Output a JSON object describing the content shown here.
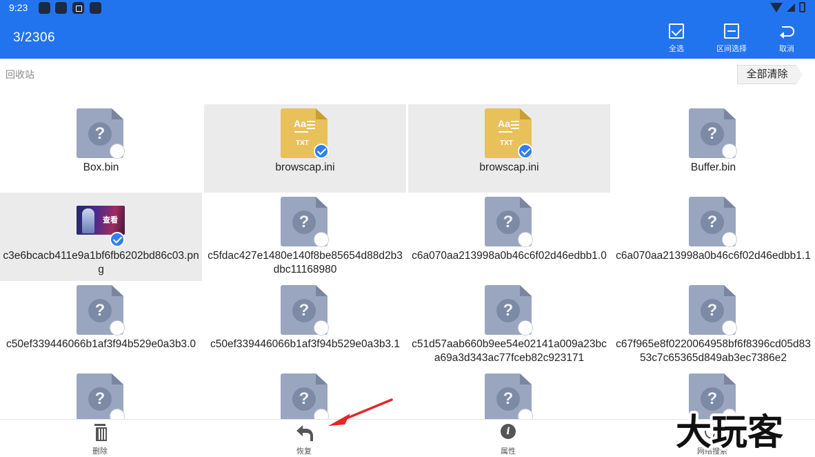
{
  "status_bar": {
    "time": "9:23"
  },
  "app_bar": {
    "selection_count": "3/2306",
    "actions": [
      {
        "label": "全选",
        "icon": "check-square-icon"
      },
      {
        "label": "区间选择",
        "icon": "range-select-icon"
      },
      {
        "label": "取消",
        "icon": "undo-icon"
      }
    ],
    "color": "#2273ee"
  },
  "breadcrumb": {
    "path": "回收站",
    "clear_all_label": "全部清除"
  },
  "files": [
    {
      "name": "Box.bin",
      "type": "unknown",
      "selected": false
    },
    {
      "name": "browscap.ini",
      "type": "txt",
      "selected": true
    },
    {
      "name": "browscap.ini",
      "type": "txt",
      "selected": true
    },
    {
      "name": "Buffer.bin",
      "type": "unknown",
      "selected": false
    },
    {
      "name": "c3e6bcacb411e9a1bf6fb6202bd86c03.png",
      "type": "image",
      "selected": true
    },
    {
      "name": "c5fdac427e1480e140f8be85654d88d2b3dbc11168980",
      "type": "unknown",
      "selected": false
    },
    {
      "name": "c6a070aa213998a0b46c6f02d46edbb1.0",
      "type": "unknown",
      "selected": false
    },
    {
      "name": "c6a070aa213998a0b46c6f02d46edbb1.1",
      "type": "unknown",
      "selected": false
    },
    {
      "name": "c50ef339446066b1af3f94b529e0a3b3.0",
      "type": "unknown",
      "selected": false
    },
    {
      "name": "c50ef339446066b1af3f94b529e0a3b3.1",
      "type": "unknown",
      "selected": false
    },
    {
      "name": "c51d57aab660b9ee54e02141a009a23bca69a3d343ac77fceb82c923171",
      "type": "unknown",
      "selected": false
    },
    {
      "name": "c67f965e8f0220064958bf6f8396cd05d8353c7c65365d849ab3ec7386e2",
      "type": "unknown",
      "selected": false
    },
    {
      "name": "",
      "type": "unknown",
      "selected": false
    },
    {
      "name": "",
      "type": "unknown",
      "selected": false
    },
    {
      "name": "",
      "type": "unknown",
      "selected": false
    },
    {
      "name": "",
      "type": "unknown",
      "selected": false
    }
  ],
  "file_icon_text": {
    "unknown": "?",
    "txt_aa": "Aa",
    "txt_tag": "TXT",
    "image_caption": "查看"
  },
  "bottom_bar": {
    "actions": [
      {
        "label": "删除",
        "icon": "trash-icon"
      },
      {
        "label": "恢复",
        "icon": "reply-icon"
      },
      {
        "label": "属性",
        "icon": "info-icon"
      },
      {
        "label": "网络搜索",
        "icon": "globe-search-icon"
      }
    ]
  },
  "info_icon_glyph": "i",
  "watermark_text": "大玩客",
  "annotation_color": "#e5262b"
}
